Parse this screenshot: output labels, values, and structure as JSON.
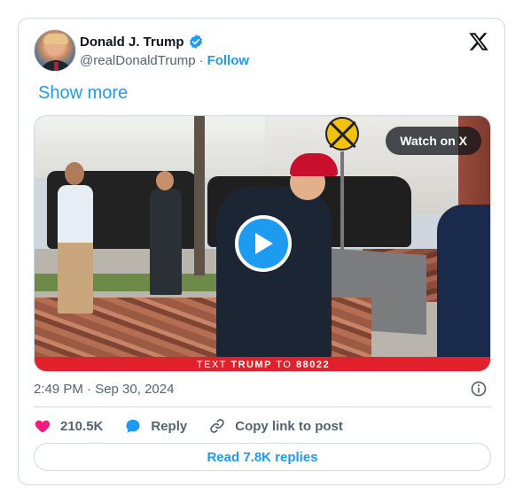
{
  "author": {
    "display_name": "Donald J. Trump",
    "handle": "@realDonaldTrump",
    "separator": "·",
    "follow_label": "Follow"
  },
  "show_more_label": "Show more",
  "media": {
    "watch_label": "Watch on X",
    "banner_prefix": "TEXT",
    "banner_keyword": "TRUMP",
    "banner_middle": "TO",
    "banner_number": "88022"
  },
  "timestamp": "2:49 PM · Sep 30, 2024",
  "actions": {
    "likes": "210.5K",
    "reply_label": "Reply",
    "copy_label": "Copy link to post"
  },
  "read_replies_label": "Read 7.8K replies",
  "colors": {
    "accent": "#1d9bf0",
    "like": "#f91880",
    "banner": "#e0202b",
    "muted": "#536471"
  },
  "icons": [
    "verified-badge-icon",
    "x-logo-icon",
    "play-icon",
    "info-icon",
    "heart-icon",
    "reply-bubble-icon",
    "link-icon"
  ]
}
